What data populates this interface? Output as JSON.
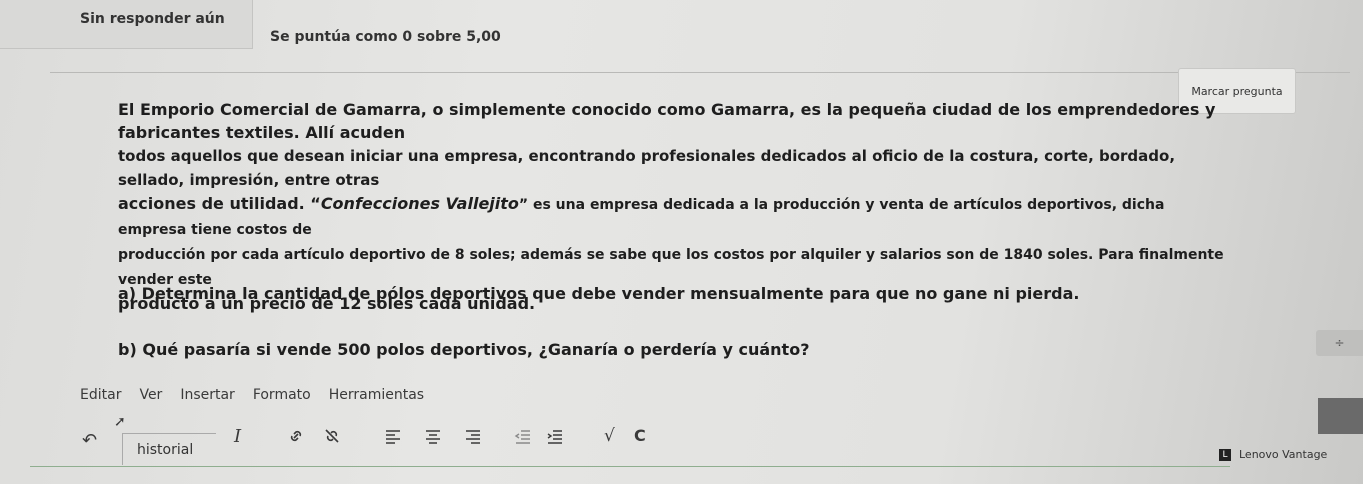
{
  "header": {
    "status": "Sin responder aún",
    "grade": "Se puntúa como 0 sobre 5,00",
    "flag_label": "Marcar pregunta"
  },
  "question": {
    "line1": "El Emporio Comercial de Gamarra, o simplemente conocido como Gamarra, es la pequeña ciudad de los emprendedores y fabricantes textiles. Allí acuden",
    "line2": "todos aquellos que desean iniciar una empresa, encontrando profesionales dedicados al oficio de la costura, corte, bordado, sellado, impresión, entre otras",
    "line3_a": "acciones de utilidad. “",
    "line3_company": "Confecciones Vallejito",
    "line3_b": "” es una empresa dedicada a la producción y venta de artículos deportivos, dicha empresa tiene costos de",
    "line4": "producción por cada artículo deportivo de 8 soles; además se sabe que los costos por alquiler y salarios son de 1840 soles. Para finalmente vender este",
    "line5": "producto a un precio de 12 soles cada unidad.",
    "item_a": "a) Determina la cantidad de pólos deportivos que debe vender mensualmente para que no gane ni pierda.",
    "item_b": "b) Qué pasaría si vende 500 polos deportivos, ¿Ganaría o perdería y cuánto?"
  },
  "editor": {
    "menu": [
      "Editar",
      "Ver",
      "Insertar",
      "Formato",
      "Herramientas"
    ],
    "style_value": "historial",
    "tools": {
      "undo": "↶",
      "italic": "I",
      "link": "link-icon",
      "unlink": "unlink-icon",
      "align_left": "align-left-icon",
      "align_center": "align-center-icon",
      "align_right": "align-right-icon",
      "outdent": "outdent-icon",
      "indent": "indent-icon",
      "sqrt": "√",
      "clear": "C"
    }
  },
  "taskbar": {
    "label": "Lenovo Vantage",
    "icon_letter": "L"
  },
  "side": {
    "button_glyph": "÷"
  }
}
